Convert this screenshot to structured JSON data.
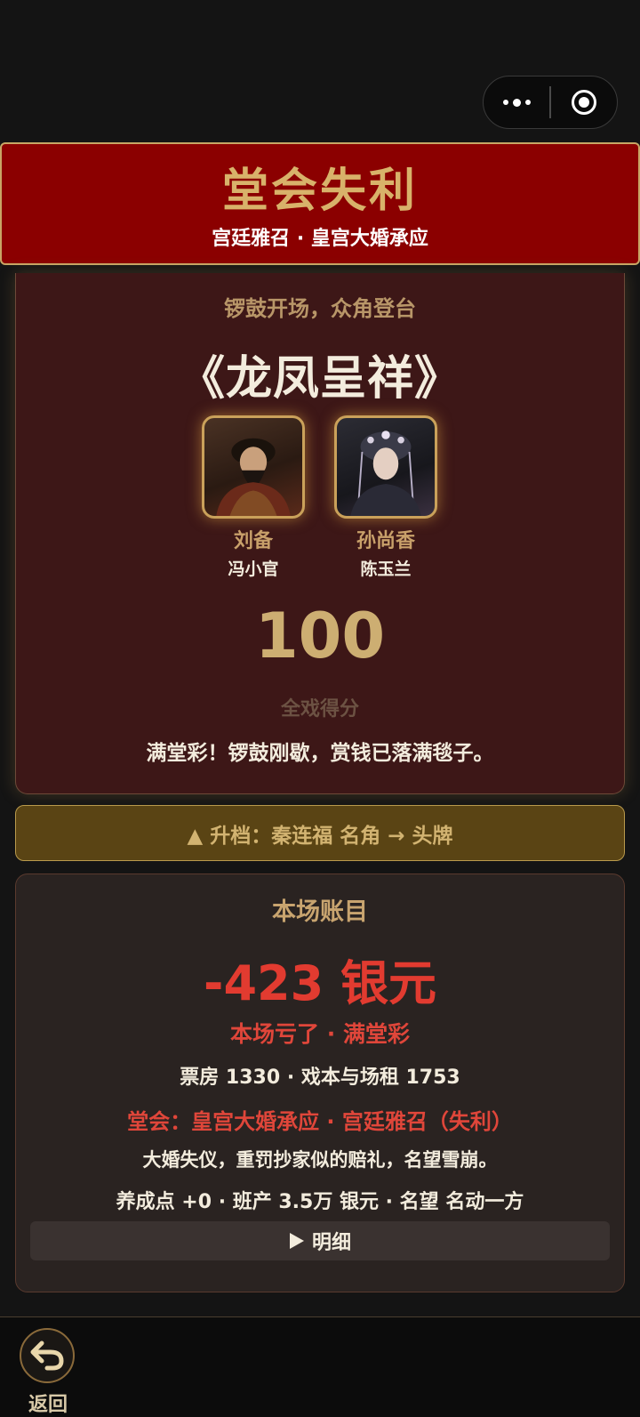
{
  "header": {
    "title": "堂会失利",
    "subtitle": "宫廷雅召 · 皇宫大婚承应"
  },
  "performance": {
    "opening": "锣鼓开场，众角登台",
    "play_title": "《龙凤呈祥》",
    "cast": [
      {
        "role": "刘备",
        "actor": "冯小官"
      },
      {
        "role": "孙尚香",
        "actor": "陈玉兰"
      }
    ],
    "score": "100",
    "score_label": "全戏得分",
    "comment": "满堂彩！锣鼓刚歇，赏钱已落满毯子。"
  },
  "upgrade": {
    "text": "▲ 升档：秦连福 名角 → 头牌"
  },
  "account": {
    "title": "本场账目",
    "amount": "-423 银元",
    "result": "本场亏了 · 满堂彩",
    "revenue_line": "票房 1330 · 戏本与场租 1753",
    "event_line": "堂会：皇宫大婚承应 · 宫廷雅召（失利）",
    "penalty_line": "大婚失仪，重罚抄家似的赔礼，名望雪崩。",
    "stats_line": "养成点 +0 · 班产 3.5万 银元 · 名望 名动一方",
    "detail_label": "明细"
  },
  "footer": {
    "back_label": "返回"
  },
  "colors": {
    "banner_red": "#8b0000",
    "gold": "#d8b26a",
    "loss_red": "#e23b30"
  }
}
